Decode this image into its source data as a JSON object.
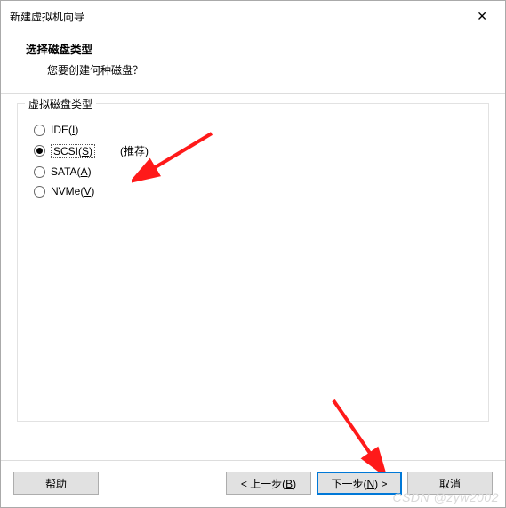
{
  "window": {
    "title": "新建虚拟机向导"
  },
  "header": {
    "title": "选择磁盘类型",
    "subtitle": "您要创建何种磁盘？"
  },
  "group": {
    "title": "虚拟磁盘类型",
    "options": [
      {
        "label_prefix": "IDE(",
        "mnemonic": "I",
        "label_suffix": ")",
        "checked": false,
        "hint": ""
      },
      {
        "label_prefix": "SCSI(",
        "mnemonic": "S",
        "label_suffix": ")",
        "checked": true,
        "hint": "(推荐)"
      },
      {
        "label_prefix": "SATA(",
        "mnemonic": "A",
        "label_suffix": ")",
        "checked": false,
        "hint": ""
      },
      {
        "label_prefix": "NVMe(",
        "mnemonic": "V",
        "label_suffix": ")",
        "checked": false,
        "hint": ""
      }
    ]
  },
  "footer": {
    "help": "帮助",
    "back_prefix": "< 上一步(",
    "back_mnemonic": "B",
    "back_suffix": ")",
    "next_prefix": "下一步(",
    "next_mnemonic": "N",
    "next_suffix": ") >",
    "cancel": "取消"
  },
  "watermark": "CSDN @zyw2002"
}
